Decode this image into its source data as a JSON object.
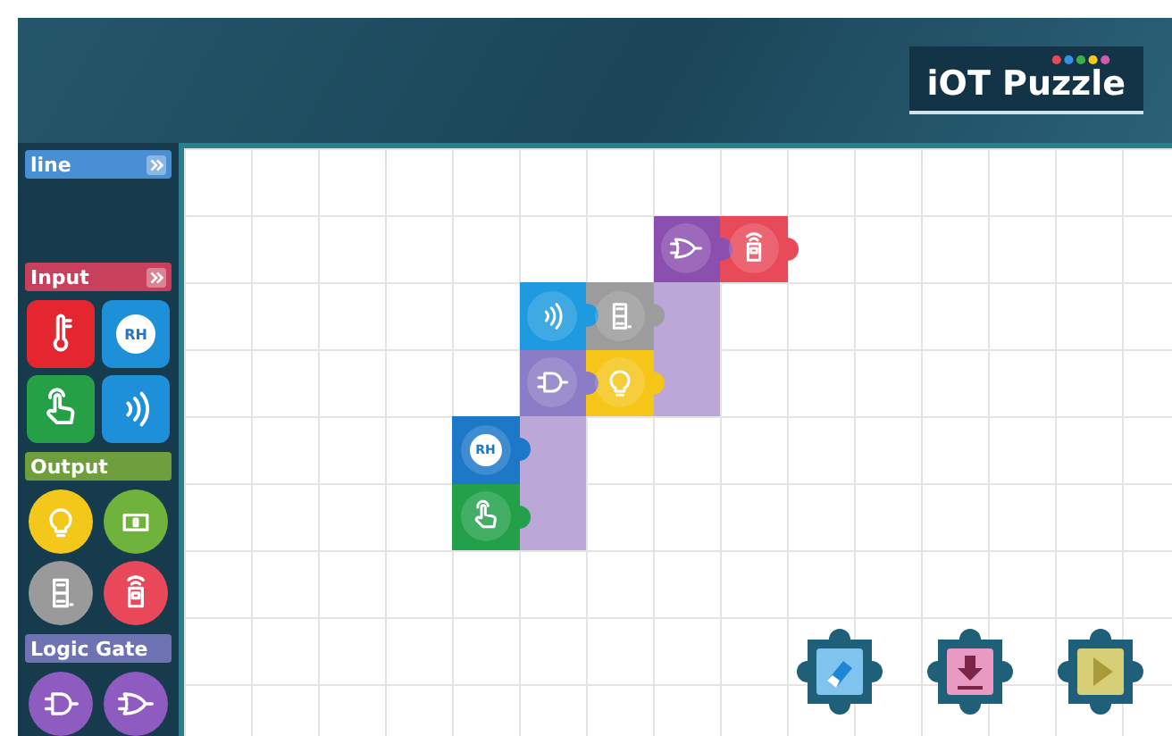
{
  "header": {
    "logo": "iOT Puzzle"
  },
  "palette": [
    {
      "title": "line",
      "color": "#4a8fd4",
      "kind": "bar"
    },
    {
      "title": "Input",
      "color": "#c9405c",
      "kind": "tiles",
      "items": [
        {
          "kind": "thermometer"
        },
        {
          "kind": "humidity",
          "label": "RH"
        },
        {
          "kind": "touch"
        },
        {
          "kind": "sound"
        }
      ]
    },
    {
      "title": "Output",
      "color": "#6e9f3c",
      "kind": "discs",
      "items": [
        {
          "kind": "bulb"
        },
        {
          "kind": "screen"
        },
        {
          "kind": "segment"
        },
        {
          "kind": "remote"
        }
      ]
    },
    {
      "title": "Logic Gate",
      "color": "#6f73b4",
      "kind": "discs",
      "items": [
        {
          "kind": "and_gate"
        },
        {
          "kind": "or_gate"
        }
      ]
    }
  ],
  "canvas": {
    "rows": [
      [
        {
          "kind": "empty"
        },
        {
          "kind": "empty"
        },
        {
          "kind": "empty"
        },
        {
          "kind": "or_gate"
        },
        {
          "kind": "remote"
        }
      ],
      [
        {
          "kind": "empty"
        },
        {
          "kind": "sound"
        },
        {
          "kind": "segment"
        },
        {
          "kind": "connector"
        },
        {
          "kind": "empty"
        }
      ],
      [
        {
          "kind": "empty"
        },
        {
          "kind": "and_gate"
        },
        {
          "kind": "bulb"
        },
        {
          "kind": "connector"
        },
        {
          "kind": "empty"
        }
      ],
      [
        {
          "kind": "humidity",
          "label": "RH"
        },
        {
          "kind": "connector"
        },
        {
          "kind": "empty"
        },
        {
          "kind": "empty"
        },
        {
          "kind": "empty"
        }
      ],
      [
        {
          "kind": "touch"
        },
        {
          "kind": "connector"
        },
        {
          "kind": "empty"
        },
        {
          "kind": "empty"
        },
        {
          "kind": "empty"
        }
      ]
    ]
  },
  "actions": [
    {
      "kind": "erase"
    },
    {
      "kind": "download"
    },
    {
      "kind": "run"
    }
  ]
}
